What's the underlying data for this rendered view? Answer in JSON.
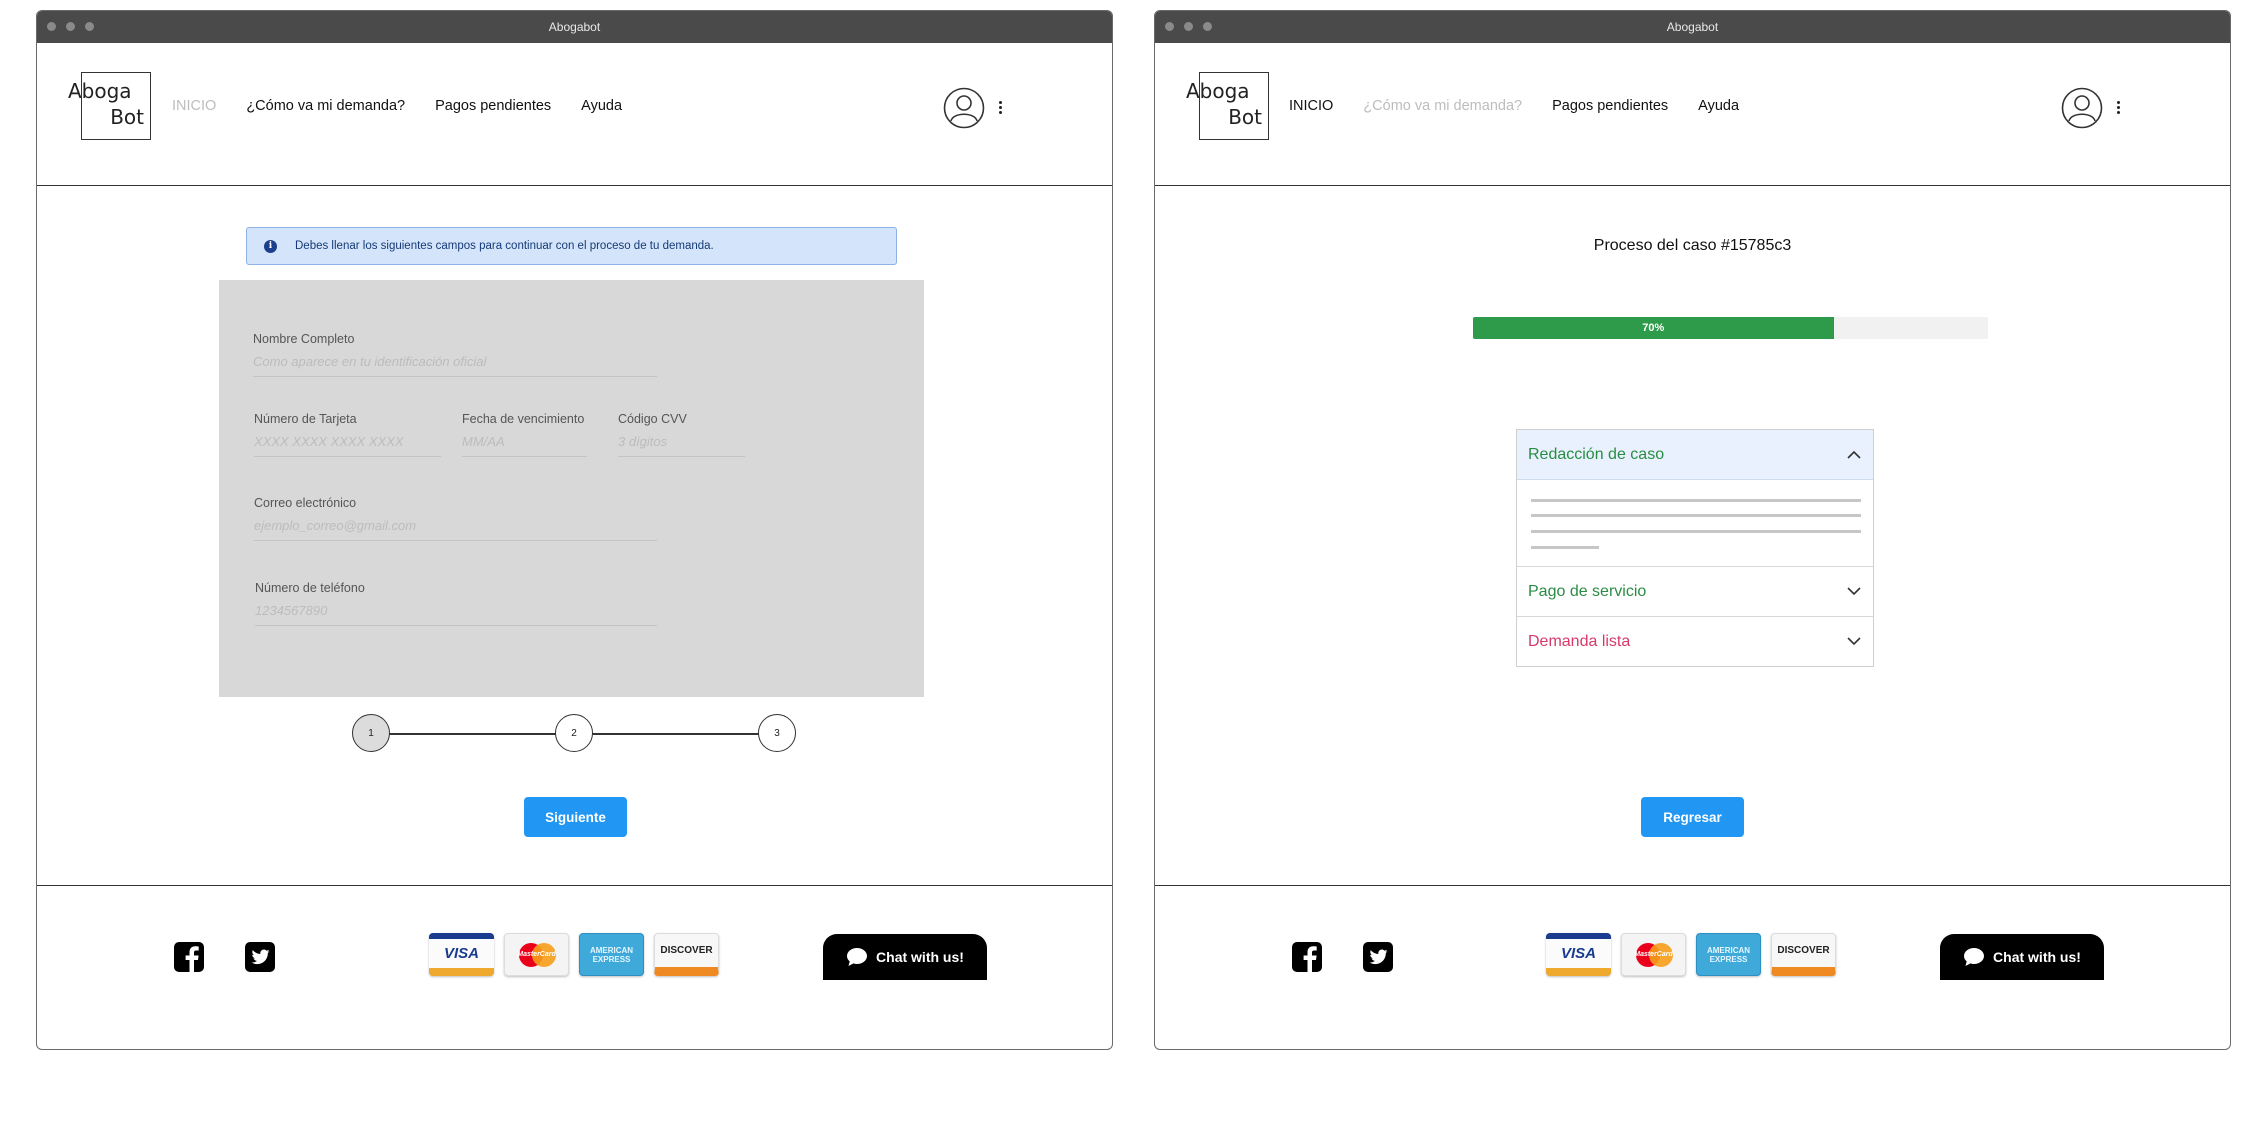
{
  "left_window": {
    "title": "Abogabot",
    "logo": {
      "line1": "Aboga",
      "line2": "Bot"
    },
    "nav": [
      "INICIO",
      "¿Cómo va mi demanda?",
      "Pagos pendientes",
      "Ayuda"
    ],
    "alert": "Debes llenar los siguientes campos para continuar con el proceso de tu demanda.",
    "form": {
      "full_name": {
        "label": "Nombre Completo",
        "placeholder": "Como aparece en tu identificación oficial"
      },
      "card_number": {
        "label": "Número de Tarjeta",
        "placeholder": "XXXX XXXX XXXX XXXX"
      },
      "expiry": {
        "label": "Fecha de vencimiento",
        "placeholder": "MM/AA"
      },
      "cvv": {
        "label": "Código CVV",
        "placeholder": "3 dígitos"
      },
      "email": {
        "label": "Correo electrónico",
        "placeholder": "ejemplo_correo@gmail.com"
      },
      "phone": {
        "label": "Número de teléfono",
        "placeholder": "1234567890"
      }
    },
    "steps": [
      "1",
      "2",
      "3"
    ],
    "next_button": "Siguiente"
  },
  "right_window": {
    "title": "Abogabot",
    "logo": {
      "line1": "Aboga",
      "line2": "Bot"
    },
    "nav": [
      "INICIO",
      "¿Cómo va mi demanda?",
      "Pagos pendientes",
      "Ayuda"
    ],
    "case_title": "Proceso del caso #15785c3",
    "progress": {
      "value": 0.7,
      "label": "70%"
    },
    "accordion": [
      {
        "label": "Redacción de caso",
        "expanded": true,
        "color": "#2a8c44"
      },
      {
        "label": "Pago de servicio",
        "expanded": false,
        "color": "#2a8c44"
      },
      {
        "label": "Demanda lista",
        "expanded": false,
        "color": "#d63a6a"
      }
    ],
    "back_button": "Regresar"
  },
  "footer": {
    "social": [
      "facebook-icon",
      "twitter-icon"
    ],
    "cards": {
      "visa": "VISA",
      "mastercard": "MasterCard",
      "amex": "AMERICAN EXPRESS",
      "discover": "DISCOVER"
    },
    "chat": "Chat with us!"
  },
  "colors": {
    "primary_button": "#2196f3",
    "progress_fill": "#2e9b4a",
    "alert_bg": "#d4e5fb"
  }
}
